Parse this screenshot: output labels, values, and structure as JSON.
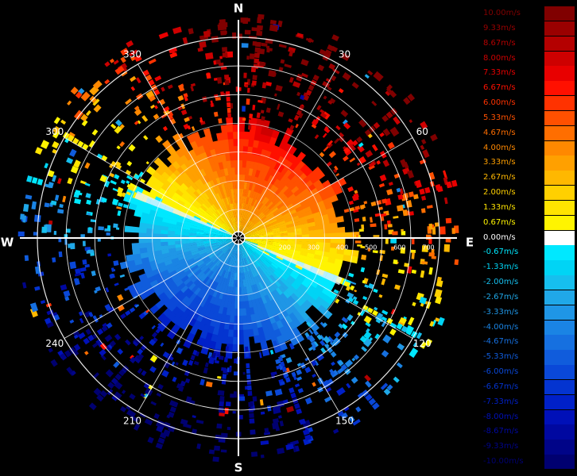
{
  "chart_data": {
    "type": "radar_ppi",
    "title": "",
    "compass": {
      "north": "N",
      "east": "E",
      "south": "S",
      "west": "W"
    },
    "azimuth_labels": [
      {
        "deg": 30,
        "label": "30"
      },
      {
        "deg": 60,
        "label": "60"
      },
      {
        "deg": 120,
        "label": "120"
      },
      {
        "deg": 150,
        "label": "150"
      },
      {
        "deg": 210,
        "label": "210"
      },
      {
        "deg": 240,
        "label": "240"
      },
      {
        "deg": 300,
        "label": "300"
      },
      {
        "deg": 330,
        "label": "330"
      }
    ],
    "range_labels": [
      {
        "value": 200,
        "label": "200"
      },
      {
        "value": 300,
        "label": "300"
      },
      {
        "value": 400,
        "label": "400"
      },
      {
        "value": 500,
        "label": "500"
      },
      {
        "value": 600,
        "label": "600"
      },
      {
        "value": 700,
        "label": "700"
      }
    ],
    "range_rings": [
      100,
      200,
      300,
      400,
      500,
      600,
      700
    ],
    "max_range": 700,
    "dense_echo_radius": 400,
    "velocity_field": {
      "zero_line_azimuth_deg": [
        113,
        293
      ],
      "approaching_half_center_deg": 23,
      "receding_half_center_deg": 203
    },
    "colorbar": {
      "unit": "m/s",
      "entries": [
        {
          "label": "10.00m/s",
          "color": "#800000"
        },
        {
          "label": "9.33m/s",
          "color": "#9a0000"
        },
        {
          "label": "8.67m/s",
          "color": "#b40000"
        },
        {
          "label": "8.00m/s",
          "color": "#ce0000"
        },
        {
          "label": "7.33m/s",
          "color": "#e80000"
        },
        {
          "label": "6.67m/s",
          "color": "#ff1000"
        },
        {
          "label": "6.00m/s",
          "color": "#ff3200"
        },
        {
          "label": "5.33m/s",
          "color": "#ff5000"
        },
        {
          "label": "4.67m/s",
          "color": "#ff6e00"
        },
        {
          "label": "4.00m/s",
          "color": "#ff8800"
        },
        {
          "label": "3.33m/s",
          "color": "#ffa000"
        },
        {
          "label": "2.67m/s",
          "color": "#ffb800"
        },
        {
          "label": "2.00m/s",
          "color": "#ffd000"
        },
        {
          "label": "1.33m/s",
          "color": "#ffe400"
        },
        {
          "label": "0.67m/s",
          "color": "#fff400"
        },
        {
          "label": "0.00m/s",
          "color": "#ffffff"
        },
        {
          "label": "-0.67m/s",
          "color": "#00e8ff"
        },
        {
          "label": "-1.33m/s",
          "color": "#00d4f5"
        },
        {
          "label": "-2.00m/s",
          "color": "#16bfee"
        },
        {
          "label": "-2.67m/s",
          "color": "#20a8e8"
        },
        {
          "label": "-3.33m/s",
          "color": "#1f96e6"
        },
        {
          "label": "-4.00m/s",
          "color": "#1a84e4"
        },
        {
          "label": "-4.67m/s",
          "color": "#1670e0"
        },
        {
          "label": "-5.33m/s",
          "color": "#105cdc"
        },
        {
          "label": "-6.00m/s",
          "color": "#0a48d8"
        },
        {
          "label": "-6.67m/s",
          "color": "#0434d0"
        },
        {
          "label": "-7.33m/s",
          "color": "#0020c8"
        },
        {
          "label": "-8.00m/s",
          "color": "#0010b8"
        },
        {
          "label": "-8.67m/s",
          "color": "#0008a0"
        },
        {
          "label": "-9.33m/s",
          "color": "#000488"
        },
        {
          "label": "-10.00m/s",
          "color": "#000070"
        }
      ]
    }
  }
}
